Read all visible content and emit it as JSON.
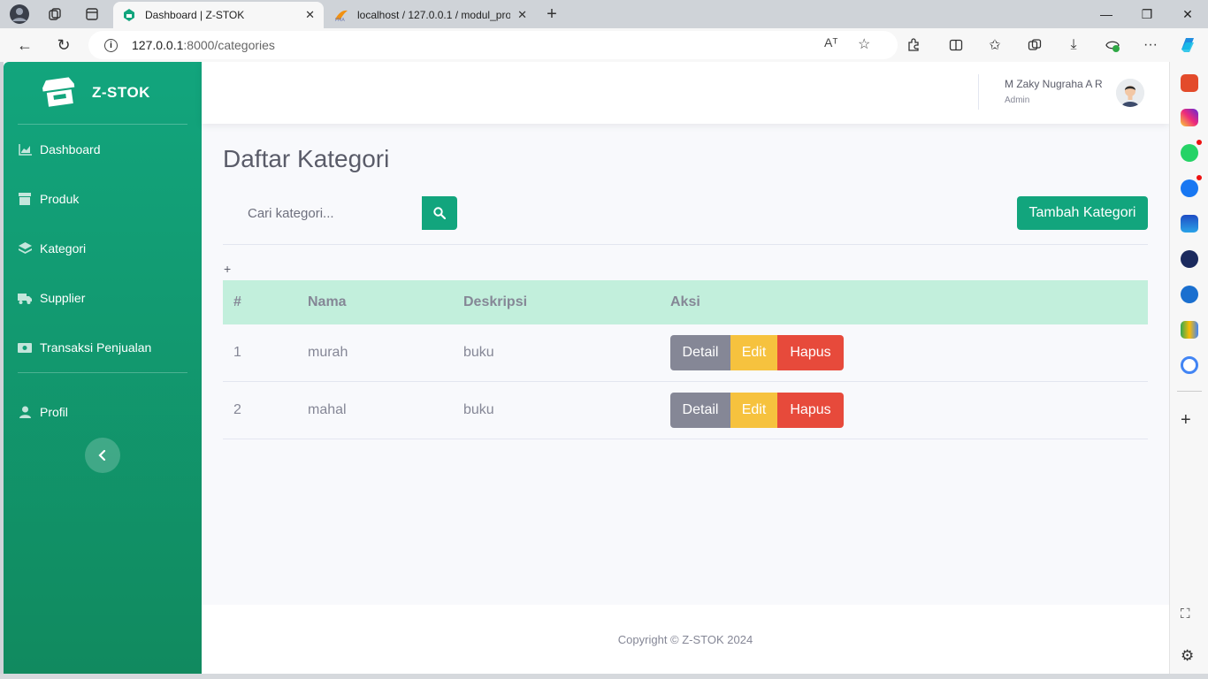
{
  "browser": {
    "tabs": [
      {
        "title": "Dashboard | Z-STOK",
        "active": true
      },
      {
        "title": "localhost / 127.0.0.1 / modul_pro",
        "active": false
      }
    ],
    "url_host": "127.0.0.1",
    "url_path": ":8000/categories",
    "read_aloud": "Aᵀ"
  },
  "sidebar": {
    "brand": "Z-STOK",
    "items": [
      {
        "label": "Dashboard",
        "icon": "chart-area-icon"
      },
      {
        "label": "Produk",
        "icon": "box-icon"
      },
      {
        "label": "Kategori",
        "icon": "layers-icon"
      },
      {
        "label": "Supplier",
        "icon": "truck-icon"
      },
      {
        "label": "Transaksi Penjualan",
        "icon": "cash-icon"
      },
      {
        "label": "Profil",
        "icon": "user-icon"
      }
    ]
  },
  "topbar": {
    "user_name": "M Zaky Nugraha A R",
    "user_role": "Admin"
  },
  "main": {
    "title": "Daftar Kategori",
    "search_placeholder": "Cari kategori...",
    "add_button": "Tambah Kategori",
    "plus_text": "+",
    "table": {
      "headers": [
        "#",
        "Nama",
        "Deskripsi",
        "Aksi"
      ],
      "rows": [
        {
          "no": "1",
          "nama": "murah",
          "deskripsi": "buku"
        },
        {
          "no": "2",
          "nama": "mahal",
          "deskripsi": "buku"
        }
      ],
      "actions": {
        "detail": "Detail",
        "edit": "Edit",
        "hapus": "Hapus"
      }
    }
  },
  "footer": {
    "text": "Copyright © Z-STOK 2024"
  },
  "colors": {
    "primary": "#12a57d",
    "table_header": "#c2efdc",
    "detail": "#858796",
    "edit": "#f6c23e",
    "hapus": "#e74a3b"
  }
}
